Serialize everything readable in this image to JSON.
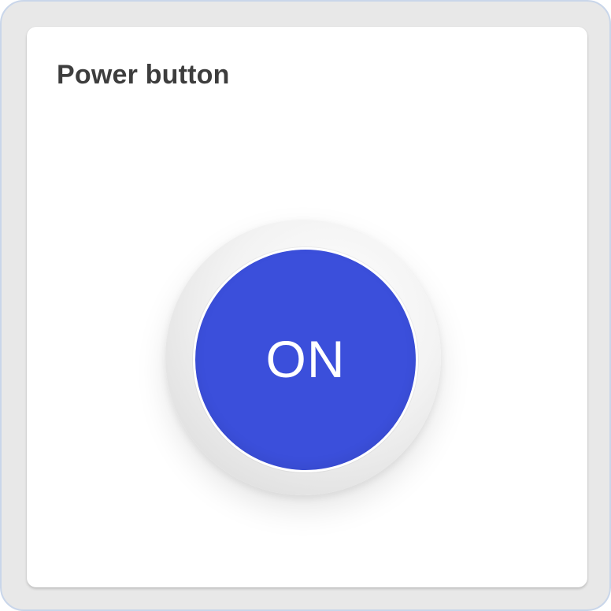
{
  "card": {
    "title": "Power button"
  },
  "power_button": {
    "label": "ON",
    "state": "on",
    "accent_color": "#3b4fdb"
  }
}
